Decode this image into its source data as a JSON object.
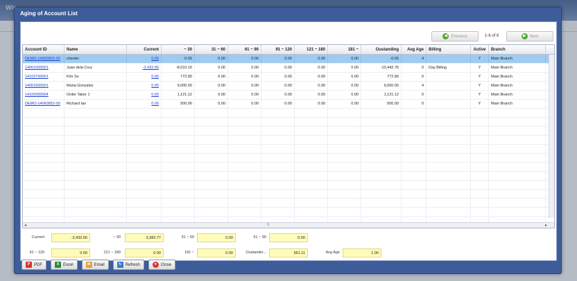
{
  "background": {
    "app_title": "Win..."
  },
  "dialog": {
    "title": "Aging of Account List",
    "pagination": {
      "previous_label": "Previous",
      "next_label": "Next",
      "page_info": "1-6 of 6"
    }
  },
  "grid": {
    "columns": [
      "Account ID",
      "Name",
      "Current",
      "~ 30",
      "31 ~ 60",
      "61 ~ 90",
      "91 ~ 120",
      "121 ~ 180",
      "181 ~",
      "Oustanding",
      "Avg Age",
      "Billing",
      "Active",
      "Branch"
    ],
    "rows": [
      [
        "DEMO-14060952-00",
        "chester",
        "0.00",
        "-0.05",
        "0.00",
        "0.00",
        "0.00",
        "0.00",
        "0.00",
        "-0.05",
        "4",
        "",
        "Y",
        "Main Branch"
      ],
      [
        "14061000001",
        "Juan dela Cruz",
        "-2,432.66",
        "-8,010.10",
        "0.00",
        "0.00",
        "0.00",
        "0.00",
        "0.00",
        "-10,442.76",
        "0",
        "Day Billing",
        "Y",
        "Main Branch"
      ],
      [
        "14102700001",
        "Kim So",
        "0.00",
        "772.80",
        "0.00",
        "0.00",
        "0.00",
        "0.00",
        "0.00",
        "772.80",
        "0",
        "",
        "Y",
        "Main Branch"
      ],
      [
        "14061600001",
        "Maria Gonzales",
        "0.00",
        "9,000.00",
        "0.00",
        "0.00",
        "0.00",
        "0.00",
        "0.00",
        "9,000.00",
        "4",
        "",
        "Y",
        "Main Branch"
      ],
      [
        "14100300004",
        "Order Taker 1",
        "0.00",
        "1,121.12",
        "0.00",
        "0.00",
        "0.00",
        "0.00",
        "0.00",
        "1,121.12",
        "0",
        "",
        "Y",
        "Main Branch"
      ],
      [
        "DEMO-14060952-00",
        "Richard Ian",
        "0.00",
        "500.00",
        "0.00",
        "0.00",
        "0.00",
        "0.00",
        "0.00",
        "500.00",
        "0",
        "",
        "Y",
        "Main Branch"
      ]
    ]
  },
  "summary": {
    "current_label": "Current",
    "current": "-2,432.66",
    "d30_label": "~ 30",
    "d30": "3,383.77",
    "d60_label": "31 ~ 60",
    "d60": "0.00",
    "d90_label": "61 ~ 90",
    "d90": "0.00",
    "d120_label": "91 ~ 120",
    "d120": "0.00",
    "d180_label": "121 ~ 180",
    "d180": "0.00",
    "d181_label": "181 ~",
    "d181": "0.00",
    "outstanding_label": "Oustandin...",
    "outstanding": "951.11",
    "avg_age_label": "Avg Age",
    "avg_age": "1.00"
  },
  "buttons": {
    "pdf": "PDF",
    "excel": "Excel",
    "email": "Email",
    "refresh": "Refresh",
    "close": "Close"
  },
  "colors": {
    "dialog_frame": "#3e5c9a",
    "selected_row": "#9fcbf0",
    "summary_field": "#fffbb8",
    "link": "#1c3fd0"
  }
}
